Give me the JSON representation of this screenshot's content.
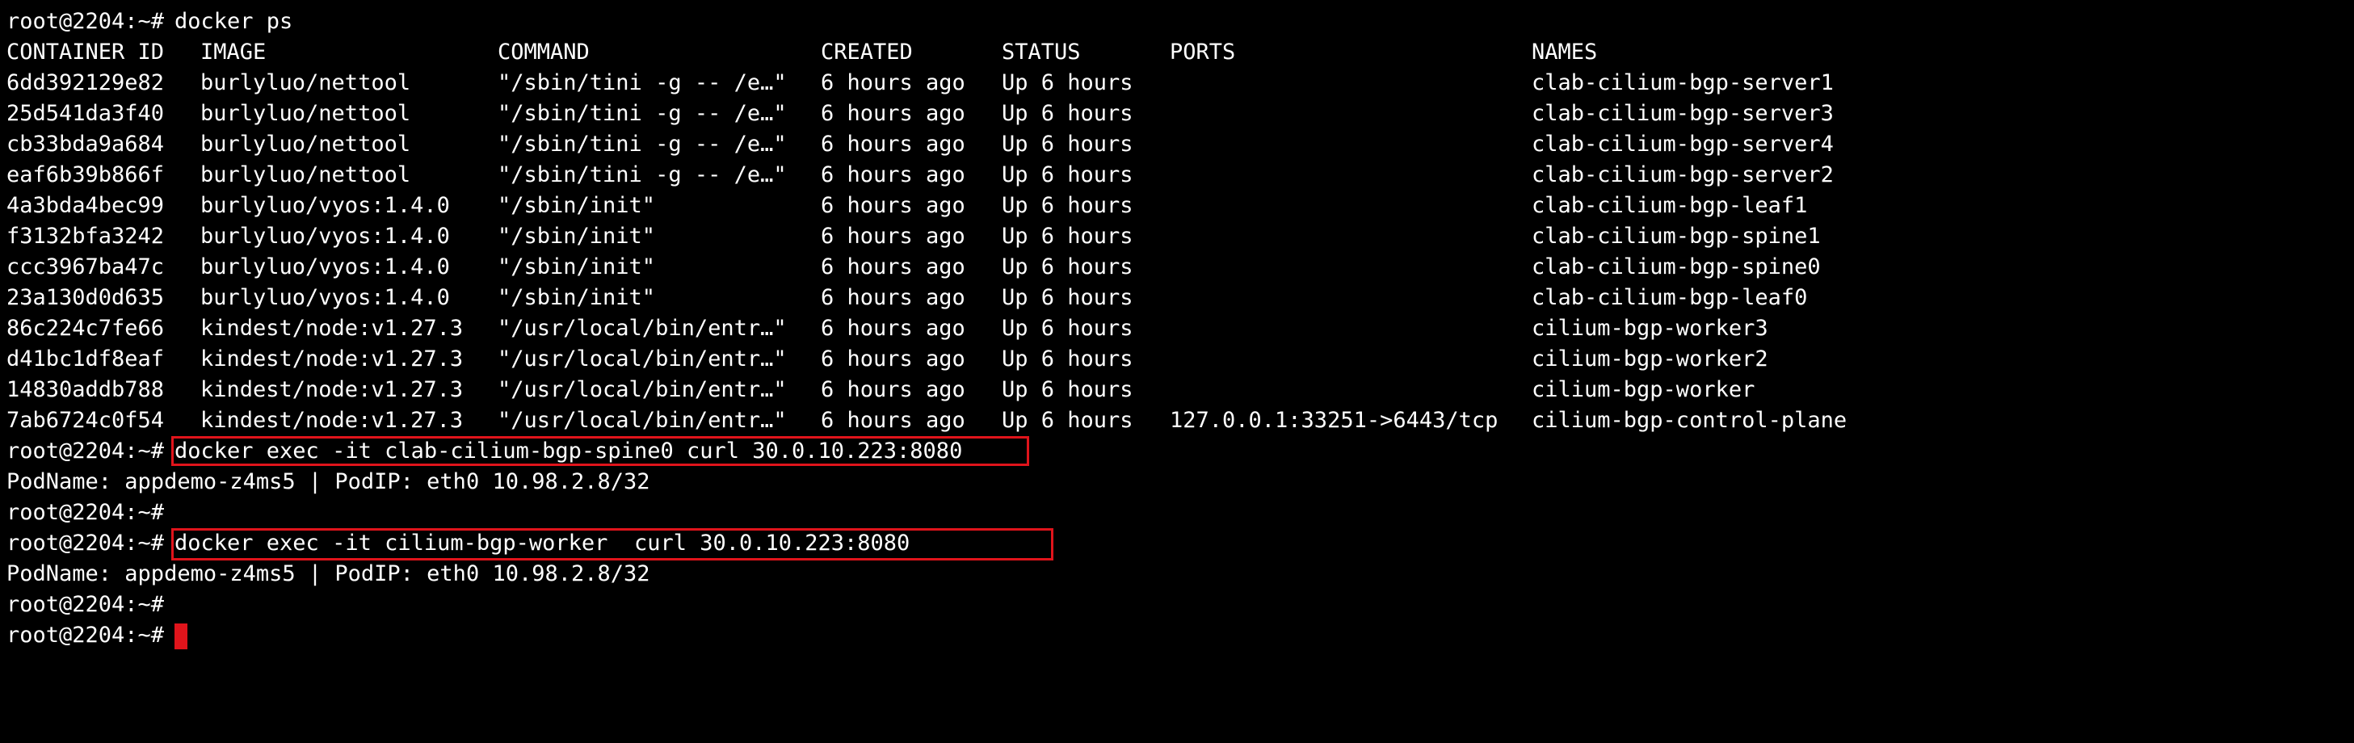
{
  "colors": {
    "background": "#000000",
    "text": "#ffffff",
    "highlight": "#e0141b",
    "cursor": "#e0141b"
  },
  "prompt": "root@2204:~#",
  "first_command": "docker ps",
  "table": {
    "headers": [
      "CONTAINER ID",
      "IMAGE",
      "COMMAND",
      "CREATED",
      "STATUS",
      "PORTS",
      "NAMES"
    ],
    "rows": [
      [
        "6dd392129e82",
        "burlyluo/nettool",
        "\"/sbin/tini -g -- /e…\"",
        "6 hours ago",
        "Up 6 hours",
        "",
        "clab-cilium-bgp-server1"
      ],
      [
        "25d541da3f40",
        "burlyluo/nettool",
        "\"/sbin/tini -g -- /e…\"",
        "6 hours ago",
        "Up 6 hours",
        "",
        "clab-cilium-bgp-server3"
      ],
      [
        "cb33bda9a684",
        "burlyluo/nettool",
        "\"/sbin/tini -g -- /e…\"",
        "6 hours ago",
        "Up 6 hours",
        "",
        "clab-cilium-bgp-server4"
      ],
      [
        "eaf6b39b866f",
        "burlyluo/nettool",
        "\"/sbin/tini -g -- /e…\"",
        "6 hours ago",
        "Up 6 hours",
        "",
        "clab-cilium-bgp-server2"
      ],
      [
        "4a3bda4bec99",
        "burlyluo/vyos:1.4.0",
        "\"/sbin/init\"",
        "6 hours ago",
        "Up 6 hours",
        "",
        "clab-cilium-bgp-leaf1"
      ],
      [
        "f3132bfa3242",
        "burlyluo/vyos:1.4.0",
        "\"/sbin/init\"",
        "6 hours ago",
        "Up 6 hours",
        "",
        "clab-cilium-bgp-spine1"
      ],
      [
        "ccc3967ba47c",
        "burlyluo/vyos:1.4.0",
        "\"/sbin/init\"",
        "6 hours ago",
        "Up 6 hours",
        "",
        "clab-cilium-bgp-spine0"
      ],
      [
        "23a130d0d635",
        "burlyluo/vyos:1.4.0",
        "\"/sbin/init\"",
        "6 hours ago",
        "Up 6 hours",
        "",
        "clab-cilium-bgp-leaf0"
      ],
      [
        "86c224c7fe66",
        "kindest/node:v1.27.3",
        "\"/usr/local/bin/entr…\"",
        "6 hours ago",
        "Up 6 hours",
        "",
        "cilium-bgp-worker3"
      ],
      [
        "d41bc1df8eaf",
        "kindest/node:v1.27.3",
        "\"/usr/local/bin/entr…\"",
        "6 hours ago",
        "Up 6 hours",
        "",
        "cilium-bgp-worker2"
      ],
      [
        "14830addb788",
        "kindest/node:v1.27.3",
        "\"/usr/local/bin/entr…\"",
        "6 hours ago",
        "Up 6 hours",
        "",
        "cilium-bgp-worker"
      ],
      [
        "7ab6724c0f54",
        "kindest/node:v1.27.3",
        "\"/usr/local/bin/entr…\"",
        "6 hours ago",
        "Up 6 hours",
        "127.0.0.1:33251->6443/tcp",
        "cilium-bgp-control-plane"
      ]
    ]
  },
  "session": {
    "cmd1": "docker exec -it clab-cilium-bgp-spine0 curl 30.0.10.223:8080",
    "out1": "PodName: appdemo-z4ms5 | PodIP: eth0 10.98.2.8/32",
    "cmd2": "docker exec -it cilium-bgp-worker  curl 30.0.10.223:8080",
    "out2": "PodName: appdemo-z4ms5 | PodIP: eth0 10.98.2.8/32"
  }
}
